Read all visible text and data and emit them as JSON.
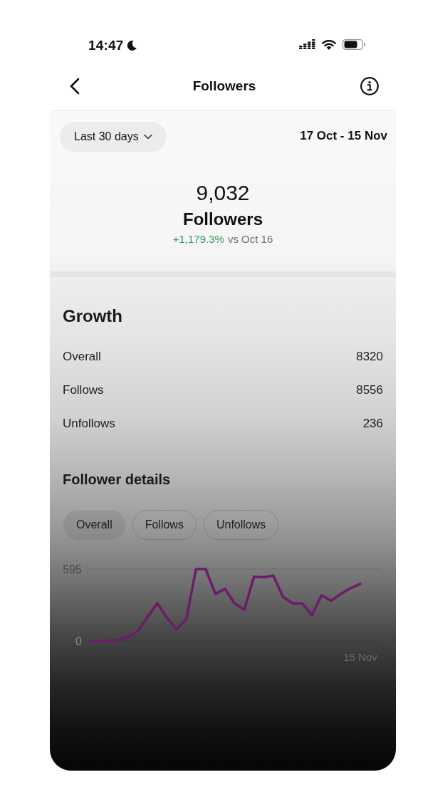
{
  "status_bar": {
    "time": "14:47"
  },
  "header": {
    "title": "Followers"
  },
  "period": {
    "label": "Last 30 days",
    "date_range": "17 Oct - 15 Nov"
  },
  "summary": {
    "total": "9,032",
    "label": "Followers",
    "change": "+1,179.3%",
    "comparison": "vs Oct 16"
  },
  "growth": {
    "title": "Growth",
    "rows": [
      {
        "label": "Overall",
        "value": "8320"
      },
      {
        "label": "Follows",
        "value": "8556"
      },
      {
        "label": "Unfollows",
        "value": "236"
      }
    ]
  },
  "details": {
    "title": "Follower details",
    "tabs": [
      {
        "label": "Overall",
        "selected": true
      },
      {
        "label": "Follows",
        "selected": false
      },
      {
        "label": "Unfollows",
        "selected": false
      }
    ],
    "chart_data": {
      "type": "line",
      "categories": [
        null,
        null,
        null,
        null,
        null,
        null,
        null,
        null,
        null,
        null,
        null,
        null,
        null,
        null,
        null,
        null,
        null,
        null,
        null,
        null,
        null,
        null,
        null,
        null,
        null,
        null,
        null,
        null,
        "15 Nov"
      ],
      "series": [
        {
          "color": "#6b1d6b",
          "values": [
            0,
            0,
            3,
            10,
            34,
            85,
            200,
            312,
            190,
            95,
            184,
            595,
            595,
            390,
            431,
            310,
            258,
            532,
            527,
            540,
            365,
            311,
            310,
            215,
            377,
            332,
            391,
            437,
            472
          ]
        }
      ],
      "ylim": [
        0,
        595
      ],
      "yticks": [
        0,
        595
      ]
    }
  }
}
